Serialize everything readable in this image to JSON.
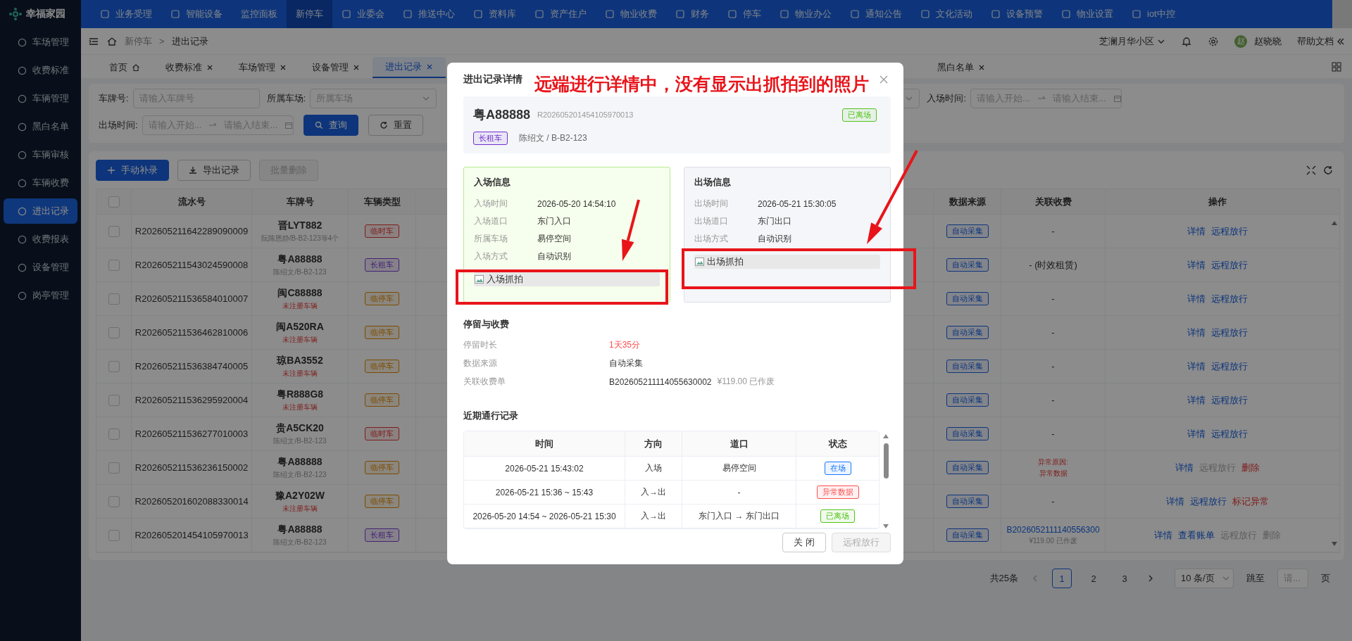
{
  "app": {
    "logo": "幸福家园"
  },
  "top_nav": [
    {
      "label": "业务受理",
      "icon": true,
      "selected": false
    },
    {
      "label": "智能设备",
      "icon": true,
      "selected": false
    },
    {
      "label": "监控面板",
      "icon": false,
      "selected": false
    },
    {
      "label": "新停车",
      "icon": false,
      "selected": true
    },
    {
      "label": "业委会",
      "icon": true,
      "selected": false
    },
    {
      "label": "推送中心",
      "icon": true,
      "selected": false
    },
    {
      "label": "资料库",
      "icon": true,
      "selected": false
    },
    {
      "label": "资产住户",
      "icon": true,
      "selected": false
    },
    {
      "label": "物业收费",
      "icon": true,
      "selected": false
    },
    {
      "label": "财务",
      "icon": true,
      "selected": false
    },
    {
      "label": "停车",
      "icon": true,
      "selected": false
    },
    {
      "label": "物业办公",
      "icon": true,
      "selected": false
    },
    {
      "label": "通知公告",
      "icon": true,
      "selected": false
    },
    {
      "label": "文化活动",
      "icon": true,
      "selected": false
    },
    {
      "label": "设备预警",
      "icon": true,
      "selected": false
    },
    {
      "label": "物业设置",
      "icon": true,
      "selected": false
    },
    {
      "label": "iot中控",
      "icon": true,
      "selected": false
    }
  ],
  "sidebar": {
    "items": [
      {
        "label": "车场管理",
        "selected": false
      },
      {
        "label": "收费标准",
        "selected": false
      },
      {
        "label": "车辆管理",
        "selected": false
      },
      {
        "label": "黑白名单",
        "selected": false
      },
      {
        "label": "车辆审核",
        "selected": false
      },
      {
        "label": "车辆收费",
        "selected": false
      },
      {
        "label": "进出记录",
        "selected": true
      },
      {
        "label": "收费报表",
        "selected": false
      },
      {
        "label": "设备管理",
        "selected": false
      },
      {
        "label": "岗亭管理",
        "selected": false
      }
    ]
  },
  "breadcrumb": {
    "items": [
      "新停车",
      "进出记录"
    ],
    "separator": ">"
  },
  "header_right": {
    "community": "芝澜月华小区",
    "avatar": "赵",
    "user": "赵晓晓",
    "help": "帮助文档"
  },
  "tabs": [
    {
      "label": "首页",
      "kind": "home",
      "selected": false
    },
    {
      "label": "收费标准",
      "kind": "closable",
      "selected": false
    },
    {
      "label": "车场管理",
      "kind": "closable",
      "selected": false
    },
    {
      "label": "设备管理",
      "kind": "closable",
      "selected": false
    },
    {
      "label": "进出记录",
      "kind": "closable",
      "selected": true
    },
    {
      "label": "黑白名单",
      "kind": "closable",
      "selected": false
    }
  ],
  "filters": {
    "row_1": [
      {
        "kind": "input",
        "label": "车牌号:",
        "placeholder": "请输入车牌号"
      },
      {
        "kind": "select",
        "label": "所属车场:",
        "placeholder": "所属车场"
      },
      {
        "kind": "select"
      },
      {
        "kind": "range",
        "label": "入场时间:",
        "start_placeholder": "请输入开始...",
        "end_placeholder": "请输入结束..."
      }
    ],
    "row_2": [
      {
        "kind": "range",
        "label": "出场时间:",
        "start_placeholder": "请输入开始...",
        "end_placeholder": "请输入结束..."
      }
    ],
    "buttons": [
      {
        "label": "查询",
        "kind": "primary"
      },
      {
        "label": "重置",
        "kind": "default"
      }
    ]
  },
  "toolbar": [
    {
      "label": "手动补录",
      "kind": "primary"
    },
    {
      "label": "导出记录",
      "kind": "default"
    },
    {
      "label": "批量删除",
      "kind": "disabled"
    }
  ],
  "table": {
    "select_all_checked": false,
    "columns_left": [
      "流水号",
      "车牌号",
      "车辆类型"
    ],
    "columns_right": [
      "数据来源",
      "关联收费",
      "操作"
    ],
    "rows": [
      {
        "checked": false,
        "serial": "R202605211642289090009",
        "plate": "晋LYT882",
        "owner": "阮陈恩静/B-B2-123等4个",
        "unregistered": false,
        "type": {
          "label": "临时车",
          "kind": "temporary"
        },
        "source": "自动采集",
        "fee": {
          "kind": "plain",
          "text": "-"
        },
        "actions": [
          {
            "label": "详情",
            "kind": "link"
          },
          {
            "label": "远程放行",
            "kind": "link"
          }
        ]
      },
      {
        "checked": false,
        "serial": "R202605211543024590008",
        "plate": "粤A88888",
        "owner": "陈绍文/B-B2-123",
        "unregistered": false,
        "type": {
          "label": "长租车",
          "kind": "rental"
        },
        "source": "自动采集",
        "fee": {
          "kind": "plain",
          "text": "- (时效租赁)"
        },
        "actions": [
          {
            "label": "详情",
            "kind": "link"
          },
          {
            "label": "远程放行",
            "kind": "link"
          }
        ]
      },
      {
        "checked": false,
        "serial": "R202605211536584010007",
        "plate": "闽C88888",
        "owner": "未注册车辆",
        "unregistered": true,
        "type": {
          "label": "临停车",
          "kind": "parking"
        },
        "source": "自动采集",
        "fee": {
          "kind": "plain",
          "text": "-"
        },
        "actions": [
          {
            "label": "详情",
            "kind": "link"
          },
          {
            "label": "远程放行",
            "kind": "link"
          }
        ]
      },
      {
        "checked": false,
        "serial": "R202605211536462810006",
        "plate": "闽A520RA",
        "owner": "未注册车辆",
        "unregistered": true,
        "type": {
          "label": "临停车",
          "kind": "parking"
        },
        "source": "自动采集",
        "fee": {
          "kind": "plain",
          "text": "-"
        },
        "actions": [
          {
            "label": "详情",
            "kind": "link"
          },
          {
            "label": "远程放行",
            "kind": "link"
          }
        ]
      },
      {
        "checked": false,
        "serial": "R202605211536384740005",
        "plate": "琼BA3552",
        "owner": "未注册车辆",
        "unregistered": true,
        "type": {
          "label": "临停车",
          "kind": "parking"
        },
        "source": "自动采集",
        "fee": {
          "kind": "plain",
          "text": "-"
        },
        "actions": [
          {
            "label": "详情",
            "kind": "link"
          },
          {
            "label": "远程放行",
            "kind": "link"
          }
        ]
      },
      {
        "checked": false,
        "serial": "R202605211536295920004",
        "plate": "粤R888G8",
        "owner": "未注册车辆",
        "unregistered": true,
        "type": {
          "label": "临停车",
          "kind": "parking"
        },
        "source": "自动采集",
        "fee": {
          "kind": "plain",
          "text": "-"
        },
        "actions": [
          {
            "label": "详情",
            "kind": "link"
          },
          {
            "label": "远程放行",
            "kind": "link"
          }
        ]
      },
      {
        "checked": false,
        "serial": "R202605211536277010003",
        "plate": "贵A5CK20",
        "owner": "陈绍文/B-B2-123",
        "unregistered": false,
        "type": {
          "label": "临时车",
          "kind": "temporary"
        },
        "source": "自动采集",
        "fee": {
          "kind": "plain",
          "text": "-"
        },
        "actions": [
          {
            "label": "详情",
            "kind": "link"
          },
          {
            "label": "远程放行",
            "kind": "link"
          }
        ]
      },
      {
        "checked": false,
        "serial": "R202605211536236150002",
        "plate": "粤A88888",
        "owner": "陈绍文/B-B2-123",
        "unregistered": false,
        "type": {
          "label": "临停车",
          "kind": "parking"
        },
        "source": "自动采集",
        "fee": {
          "kind": "error",
          "text": "异常原因:",
          "sub": "异常数据"
        },
        "actions": [
          {
            "label": "详情",
            "kind": "link"
          },
          {
            "label": "远程放行",
            "kind": "disabled"
          },
          {
            "label": "删除",
            "kind": "danger"
          }
        ]
      },
      {
        "checked": false,
        "serial": "R202605201602088330014",
        "plate": "豫A2Y02W",
        "owner": "未注册车辆",
        "unregistered": true,
        "type": {
          "label": "临停车",
          "kind": "parking"
        },
        "source": "自动采集",
        "fee": {
          "kind": "plain",
          "text": "-"
        },
        "actions": [
          {
            "label": "详情",
            "kind": "link"
          },
          {
            "label": "远程放行",
            "kind": "link"
          },
          {
            "label": "标记异常",
            "kind": "danger"
          }
        ]
      },
      {
        "checked": false,
        "serial": "R202605201454105970013",
        "plate": "粤A88888",
        "owner": "陈绍文/B-B2-123",
        "unregistered": false,
        "type": {
          "label": "长租车",
          "kind": "rental"
        },
        "source": "自动采集",
        "fee": {
          "kind": "link",
          "text": "B2026052111140556300",
          "sub": "¥119.00 已作废"
        },
        "actions": [
          {
            "label": "详情",
            "kind": "link"
          },
          {
            "label": "查看账单",
            "kind": "link"
          },
          {
            "label": "远程放行",
            "kind": "disabled"
          },
          {
            "label": "删除",
            "kind": "disabled"
          }
        ]
      }
    ]
  },
  "pagination": {
    "total": "共25条",
    "pages": [
      {
        "label": "1",
        "selected": true
      },
      {
        "label": "2",
        "selected": false
      },
      {
        "label": "3",
        "selected": false
      }
    ],
    "page_size": "10 条/页",
    "jump_label": "跳至",
    "jump_placeholder": "请...",
    "page_suffix": "页"
  },
  "modal": {
    "title": "进出记录详情",
    "plate": "粤A88888",
    "serial": "R202605201454105970013",
    "status_tag": {
      "label": "已离场",
      "color": "#52c41a"
    },
    "type_tag": {
      "label": "长租车",
      "color": "#722ed1"
    },
    "owner": "陈绍文 / B-B2-123",
    "cards": [
      {
        "kind": "entry",
        "title": "入场信息",
        "fields": [
          {
            "label": "入场时间",
            "value": "2026-05-20 14:54:10"
          },
          {
            "label": "入场道口",
            "value": "东门入口"
          },
          {
            "label": "所属车场",
            "value": "易停空间"
          },
          {
            "label": "入场方式",
            "value": "自动识别"
          }
        ],
        "photo_alt": "入场抓拍"
      },
      {
        "kind": "exit",
        "title": "出场信息",
        "fields": [
          {
            "label": "出场时间",
            "value": "2026-05-21 15:30:05"
          },
          {
            "label": "出场道口",
            "value": "东门出口"
          },
          {
            "label": "出场方式",
            "value": "自动识别"
          }
        ],
        "photo_alt": "出场抓拍"
      }
    ],
    "stay": {
      "title": "停留与收费",
      "fields": [
        {
          "kind": "alert",
          "label": "停留时长",
          "value": "1天35分"
        },
        {
          "kind": "plain",
          "label": "数据来源",
          "value": "自动采集"
        },
        {
          "kind": "bill",
          "label": "关联收费单",
          "value": "B202605211114055630002",
          "extra": "¥119.00 已作废"
        }
      ]
    },
    "recent": {
      "title": "近期通行记录",
      "columns": [
        "时间",
        "方向",
        "道口",
        "状态"
      ],
      "rows": [
        {
          "time": "2026-05-21 15:43:02",
          "direction": "入场",
          "gate": "易停空间",
          "status": {
            "label": "在场",
            "color": "#1677ff"
          }
        },
        {
          "time": "2026-05-21 15:36 ~ 15:43",
          "direction": "入→出",
          "gate": "-",
          "status": {
            "label": "异常数据",
            "color": "#ff4d4f"
          }
        },
        {
          "time": "2026-05-20 14:54 ~ 2026-05-21 15:30",
          "direction": "入→出",
          "gate": "东门入口 → 东门出口",
          "status": {
            "label": "已离场",
            "color": "#52c41a"
          }
        }
      ]
    },
    "buttons": [
      {
        "label": "关 闭",
        "kind": "default"
      },
      {
        "label": "远程放行",
        "kind": "disabled"
      }
    ]
  },
  "annotation": {
    "text": "远端进行详情中，没有显示出抓拍到的照片"
  }
}
